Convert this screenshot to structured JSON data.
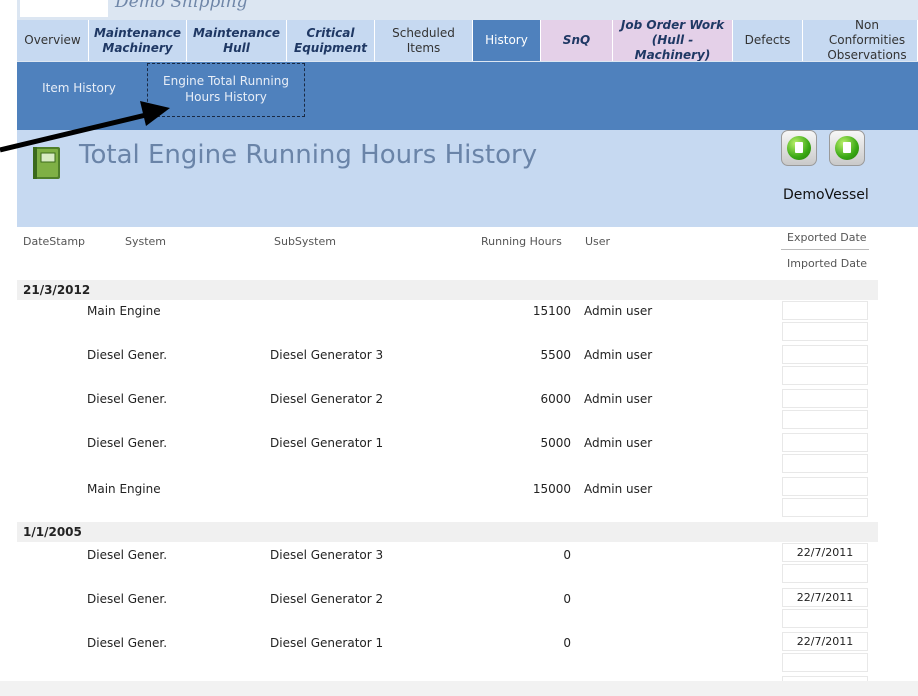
{
  "app": {
    "name": "Demo Shipping"
  },
  "tabs": [
    {
      "label": "Overview",
      "style": "normal"
    },
    {
      "label": "Maintenance Machinery",
      "style": "bi"
    },
    {
      "label": "Maintenance Hull",
      "style": "bi"
    },
    {
      "label": "Critical Equipment",
      "style": "bi"
    },
    {
      "label": "Scheduled Items",
      "style": "normal"
    },
    {
      "label": "History",
      "style": "sel"
    },
    {
      "label": "SnQ",
      "style": "snq"
    },
    {
      "label": "Job Order Work (Hull - Machinery)",
      "style": "jow"
    },
    {
      "label": "Defects",
      "style": "normal"
    },
    {
      "label": "Non Conformities Observations",
      "style": "normal"
    }
  ],
  "subtabs": {
    "item_history": "Item History",
    "engine_history": "Engine Total Running Hours History"
  },
  "header": {
    "title": "Total Engine Running Hours History",
    "vessel": "DemoVessel",
    "btn1_icon": "export-document-icon",
    "btn2_icon": "print-document-icon"
  },
  "columns": {
    "datestamp": "DateStamp",
    "system": "System",
    "subsystem": "SubSystem",
    "running_hours": "Running Hours",
    "user": "User",
    "exported": "Exported Date",
    "imported": "Imported Date"
  },
  "groups": [
    {
      "date": "21/3/2012",
      "rows": [
        {
          "system": "Main Engine",
          "subsystem": "",
          "hours": "15100",
          "user": "Admin user",
          "exported": ""
        },
        {
          "system": "Diesel Gener.",
          "subsystem": "Diesel Generator 3",
          "hours": "5500",
          "user": "Admin user",
          "exported": ""
        },
        {
          "system": "Diesel Gener.",
          "subsystem": "Diesel Generator 2",
          "hours": "6000",
          "user": "Admin user",
          "exported": ""
        },
        {
          "system": "Diesel Gener.",
          "subsystem": "Diesel Generator 1",
          "hours": "5000",
          "user": "Admin user",
          "exported": ""
        },
        {
          "system": "Main Engine",
          "subsystem": "",
          "hours": "15000",
          "user": "Admin user",
          "exported": ""
        }
      ]
    },
    {
      "date": "1/1/2005",
      "rows": [
        {
          "system": "Diesel Gener.",
          "subsystem": "Diesel Generator 3",
          "hours": "0",
          "user": "",
          "exported": "22/7/2011"
        },
        {
          "system": "Diesel Gener.",
          "subsystem": "Diesel Generator 2",
          "hours": "0",
          "user": "",
          "exported": "22/7/2011"
        },
        {
          "system": "Diesel Gener.",
          "subsystem": "Diesel Generator 1",
          "hours": "0",
          "user": "",
          "exported": "22/7/2011"
        }
      ]
    }
  ],
  "colors": {
    "tab_bg": "#c6d9f1",
    "selected_tab": "#4f81bd",
    "subbar": "#4f81bd",
    "header_bg": "#c6d9f1",
    "title": "#6a84a8"
  }
}
